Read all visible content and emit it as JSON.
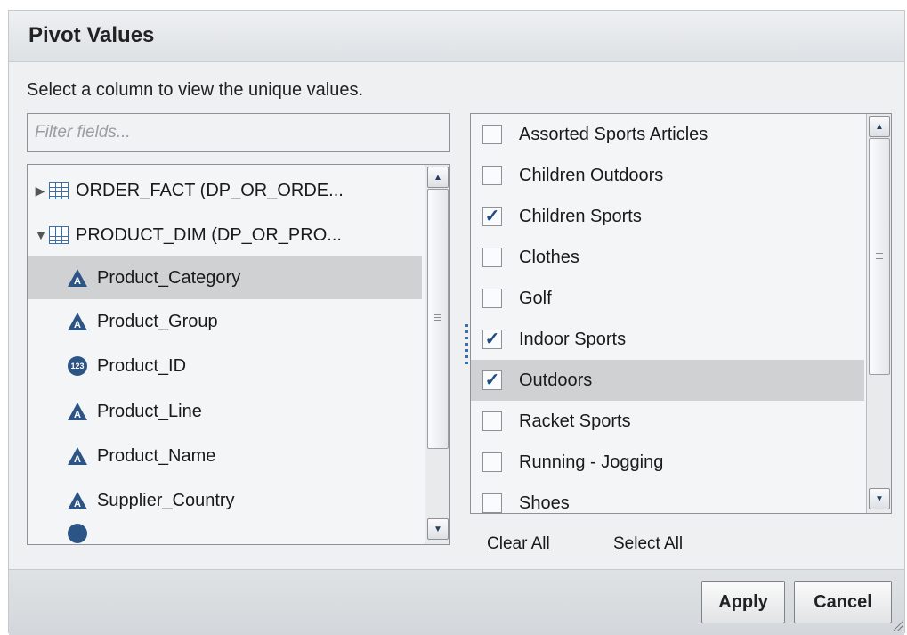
{
  "dialog": {
    "title": "Pivot Values",
    "instruction": "Select a column to view the unique values."
  },
  "filter": {
    "placeholder": "Filter fields...",
    "value": ""
  },
  "tree": {
    "tables": [
      {
        "label": "ORDER_FACT (DP_OR_ORDE...",
        "expanded": false
      },
      {
        "label": "PRODUCT_DIM (DP_OR_PRO...",
        "expanded": true
      }
    ],
    "columns": [
      {
        "label": "Product_Category",
        "type": "character",
        "selected": true
      },
      {
        "label": "Product_Group",
        "type": "character",
        "selected": false
      },
      {
        "label": "Product_ID",
        "type": "numeric",
        "selected": false
      },
      {
        "label": "Product_Line",
        "type": "character",
        "selected": false
      },
      {
        "label": "Product_Name",
        "type": "character",
        "selected": false
      },
      {
        "label": "Supplier_Country",
        "type": "character",
        "selected": false
      }
    ],
    "numeric_badge": "123"
  },
  "values": [
    {
      "label": "Assorted Sports Articles",
      "checked": false,
      "selected": false
    },
    {
      "label": "Children Outdoors",
      "checked": false,
      "selected": false
    },
    {
      "label": "Children Sports",
      "checked": true,
      "selected": false
    },
    {
      "label": "Clothes",
      "checked": false,
      "selected": false
    },
    {
      "label": "Golf",
      "checked": false,
      "selected": false
    },
    {
      "label": "Indoor Sports",
      "checked": true,
      "selected": false
    },
    {
      "label": "Outdoors",
      "checked": true,
      "selected": true
    },
    {
      "label": "Racket Sports",
      "checked": false,
      "selected": false
    },
    {
      "label": "Running - Jogging",
      "checked": false,
      "selected": false
    },
    {
      "label": "Shoes",
      "checked": false,
      "selected": false
    }
  ],
  "links": {
    "clear_all": "Clear All",
    "select_all": "Select All"
  },
  "buttons": {
    "apply": "Apply",
    "cancel": "Cancel"
  },
  "icons": {
    "table": "table-icon",
    "character_column": "character-column-icon",
    "numeric_column": "numeric-column-icon",
    "expand": "chevron-right-icon",
    "collapse": "chevron-down-icon",
    "check": "checkmark-icon"
  },
  "colors": {
    "accent": "#3a6fae",
    "selection": "#cfd1d3",
    "icon_dark": "#2c5586"
  }
}
